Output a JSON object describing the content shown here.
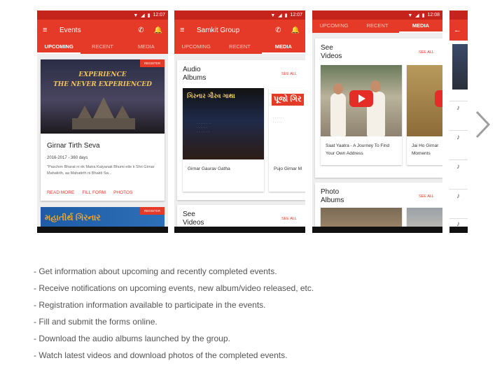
{
  "screens": [
    {
      "status_time": "12:07",
      "app_title": "Events",
      "tabs": [
        "UPCOMING",
        "RECENT",
        "MEDIA"
      ],
      "active_tab": 0,
      "event": {
        "badge": "REGISTER",
        "tagline_1": "EXPERIENCE",
        "tagline_2": "THE NEVER EXPERIENCED",
        "title": "Girnar Tirth Seva",
        "dates": "2016-2017 - 360 days",
        "description": "\"Paschim Bharat ni ek Matra Kalyanak Bhumi etle k Shri Girnar Mahatirth, aa Mahatirth ni Bhakti Sw...",
        "actions": [
          "READ MORE",
          "FILL FORM",
          "PHOTOS"
        ]
      },
      "next_card": {
        "badge": "REGISTER",
        "script_text": "મહાતીર્થ ગિરનાર"
      }
    },
    {
      "status_time": "12:07",
      "app_title": "Samkit Group",
      "tabs": [
        "UPCOMING",
        "RECENT",
        "MEDIA"
      ],
      "active_tab": 2,
      "sections": [
        {
          "title": "Audio\nAlbums",
          "see_all": "SEE ALL",
          "items": [
            {
              "caption": "Girnar Gaurav Gatha",
              "art_title": "ગિરનાર ગૌરવ ગાથા"
            },
            {
              "caption": "Pujo Girnar M",
              "art_title": "પૂજો ગિર"
            }
          ]
        },
        {
          "title": "See\nVideos",
          "see_all": "SEE ALL"
        }
      ]
    },
    {
      "status_time": "12:08",
      "tabs": [
        "UPCOMING",
        "RECENT",
        "MEDIA"
      ],
      "active_tab": 2,
      "sections": [
        {
          "title": "See\nVideos",
          "see_all": "SEE ALL",
          "items": [
            {
              "caption": "Saat Yaatra - A Journey To Find Your Own Address"
            },
            {
              "caption": "Jai Ho Girnar Moments"
            }
          ]
        },
        {
          "title": "Photo\nAlbums",
          "see_all": "SEE ALL"
        }
      ]
    },
    {
      "back_icon": "arrow-left-icon",
      "list_icons": [
        "music-note-icon",
        "music-note-icon",
        "music-note-icon",
        "music-note-icon",
        "music-note-icon"
      ]
    }
  ],
  "features": [
    "- Get information about upcoming and recently completed events.",
    "- Receive notifications on upcoming events, new album/video released, etc.",
    "- Registration information available to participate in the events.",
    "- Fill and submit the forms online.",
    "- Download the audio albums launched by the group.",
    "- Watch latest videos and download photos of the completed events."
  ],
  "colors": {
    "primary": "#e53a27",
    "status_bar": "#c4241b",
    "accent_text": "#e53a27"
  }
}
